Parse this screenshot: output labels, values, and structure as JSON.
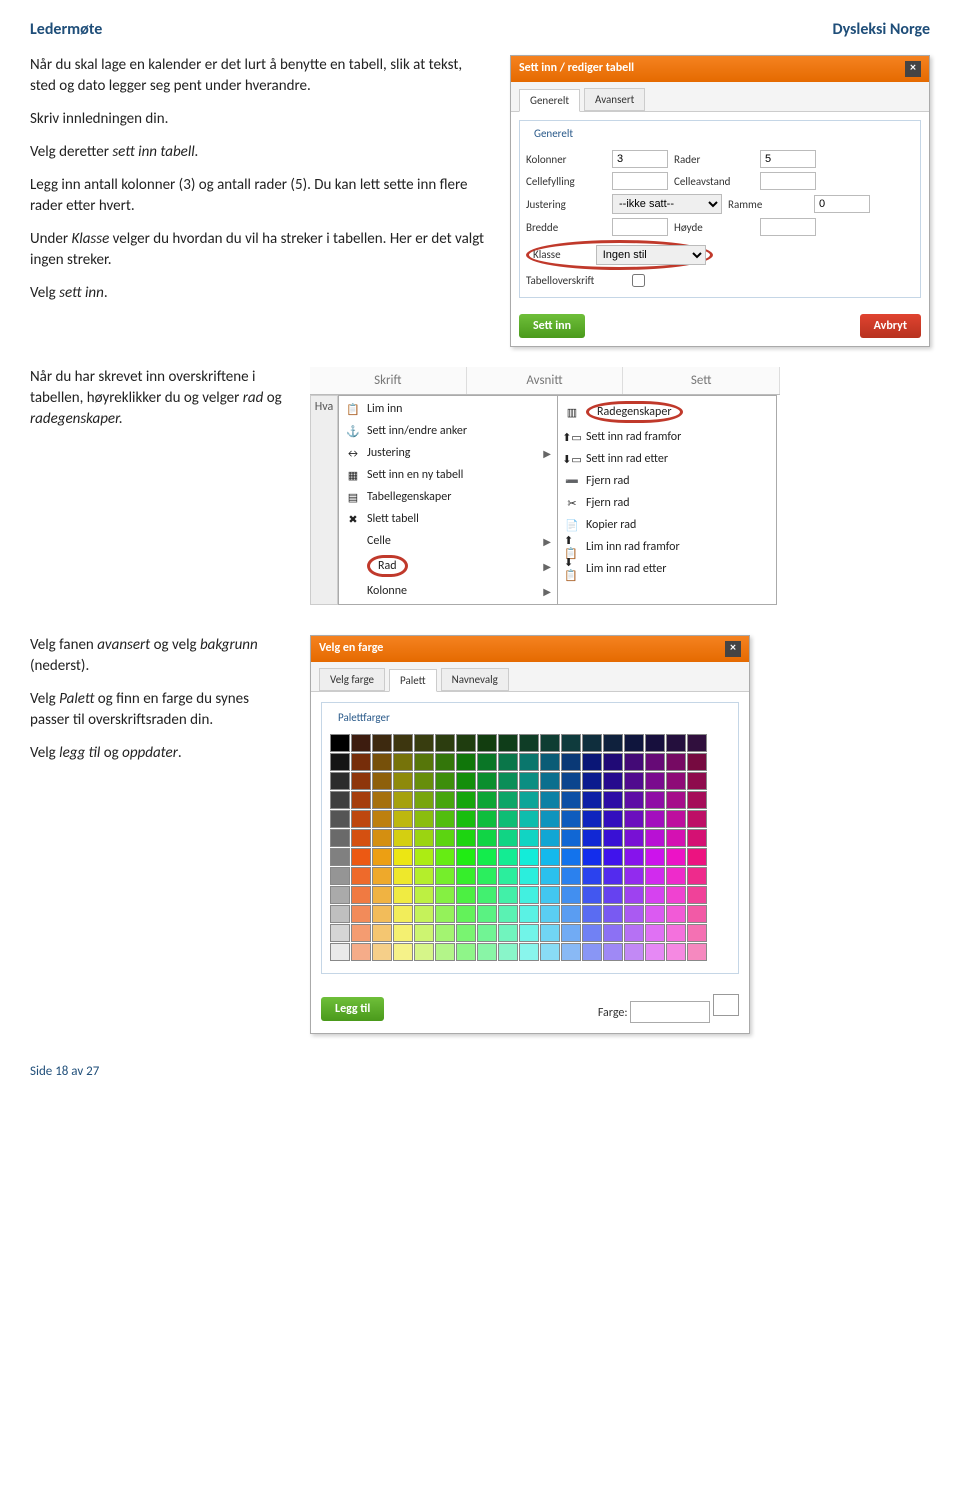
{
  "header": {
    "left": "Ledermøte",
    "right": "Dysleksi Norge"
  },
  "body": {
    "p1": "Når du skal lage en kalender er det lurt å benytte en tabell, slik at tekst, sted og dato legger seg pent under hverandre.",
    "p2": "Skriv innledningen din.",
    "p3_a": "Velg deretter ",
    "p3_i": "sett inn tabell.",
    "p4": "Legg inn antall kolonner (3) og antall rader (5). Du kan lett sette inn flere rader etter hvert.",
    "p5_a": "Under ",
    "p5_i": "Klasse",
    "p5_b": " velger du hvordan du vil ha streker i tabellen. Her er det valgt ingen streker.",
    "p6_a": "Velg ",
    "p6_i": "sett inn",
    "p6_b": ".",
    "p7_a": "Når du har skrevet inn overskriftene i tabellen, høyreklikker du og velger ",
    "p7_i1": "rad",
    "p7_m": " og ",
    "p7_i2": "radegenskaper.",
    "p8_a": "Velg fanen ",
    "p8_i": "avansert",
    "p8_b": " og velg ",
    "p8_i2": "bakgrunn",
    "p8_c": " (nederst).",
    "p9_a": "Velg ",
    "p9_i": "Palett",
    "p9_b": " og finn en farge du synes passer til overskriftsraden din.",
    "p10_a": "Velg ",
    "p10_i": "legg til",
    "p10_b": " og ",
    "p10_i2": "oppdater",
    "p10_c": "."
  },
  "dlg1": {
    "title": "Sett inn / rediger tabell",
    "tab1": "Generelt",
    "tab2": "Avansert",
    "legend": "Generelt",
    "l_kolonner": "Kolonner",
    "v_kolonner": "3",
    "l_rader": "Rader",
    "v_rader": "5",
    "l_cellefylling": "Cellefylling",
    "l_celleavstand": "Celleavstand",
    "l_justering": "Justering",
    "v_justering": "--ikke satt--",
    "l_ramme": "Ramme",
    "v_ramme": "0",
    "l_bredde": "Bredde",
    "l_hoyde": "Høyde",
    "l_klasse": "Klasse",
    "v_klasse": "Ingen stil",
    "l_tabov": "Tabelloverskrift",
    "btn_ok": "Sett inn",
    "btn_cancel": "Avbryt"
  },
  "ctx": {
    "tabs": [
      "Skrift",
      "Avsnitt",
      "Sett"
    ],
    "sidechar": "Hva",
    "left": [
      {
        "icon": "📋",
        "label": "Lim inn"
      },
      {
        "icon": "⚓",
        "label": "Sett inn/endre anker"
      },
      {
        "icon": "↔",
        "label": "Justering",
        "sub": true
      },
      {
        "icon": "▦",
        "label": "Sett inn en ny tabell"
      },
      {
        "icon": "▤",
        "label": "Tabellegenskaper"
      },
      {
        "icon": "✖",
        "label": "Slett tabell"
      },
      {
        "icon": "",
        "label": "Celle",
        "sub": true
      },
      {
        "icon": "",
        "label": "Rad",
        "sub": true,
        "mark": true
      },
      {
        "icon": "",
        "label": "Kolonne",
        "sub": true
      }
    ],
    "right": [
      {
        "icon": "▥",
        "label": "Radegenskaper",
        "mark": true
      },
      {
        "icon": "⬆▭",
        "label": "Sett inn rad framfor"
      },
      {
        "icon": "⬇▭",
        "label": "Sett inn rad etter"
      },
      {
        "icon": "➖",
        "label": "Fjern rad"
      },
      {
        "icon": "✂",
        "label": "Fjern rad"
      },
      {
        "icon": "📄",
        "label": "Kopier rad"
      },
      {
        "icon": "⬆📋",
        "label": "Lim inn rad framfor"
      },
      {
        "icon": "⬇📋",
        "label": "Lim inn rad etter"
      }
    ]
  },
  "dlg3": {
    "title": "Velg en farge",
    "tabs": [
      "Velg farge",
      "Palett",
      "Navnevalg"
    ],
    "legend": "Palettfarger",
    "btn": "Legg til",
    "foot_lbl": "Farge:"
  },
  "footer": "Side 18 av 27",
  "chart_data": {
    "type": "table",
    "title": "Palettfarger",
    "columns": 18,
    "rows": 12,
    "note": "18×12 swatch grid of selectable colors (black→white, reds, violets, blues, greens, yellows spectrum)"
  }
}
